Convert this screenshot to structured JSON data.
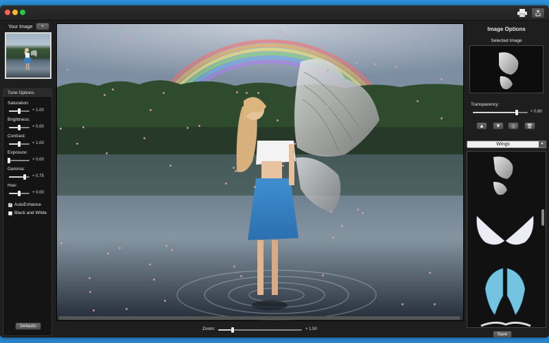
{
  "left_panel": {
    "title": "Your Image",
    "add_label": "+",
    "tune_title": "Tune Options",
    "sliders": [
      {
        "label": "Saturation:",
        "value": "+ 1.00",
        "level": 0.5
      },
      {
        "label": "Brightness:",
        "value": "+ 0.00",
        "level": 0.5
      },
      {
        "label": "Contrast:",
        "value": "+ 1.00",
        "level": 0.5
      },
      {
        "label": "Exposure:",
        "value": "+ 0.00",
        "level": 0.0
      },
      {
        "label": "Gamma:",
        "value": "+ 0.75",
        "level": 0.75
      },
      {
        "label": "Hue:",
        "value": "+ 0.00",
        "level": 0.5
      }
    ],
    "auto_enhance": {
      "label": "AutoEnhance",
      "checked": true
    },
    "black_white": {
      "label": "Black and White",
      "checked": false
    },
    "defaults_label": "Defaults"
  },
  "bottom": {
    "zoom_label": "Zoom:",
    "zoom_value": "+ 1.50",
    "zoom_level": 0.17
  },
  "right_panel": {
    "title": "Image Options",
    "selected_label": "Selected Image",
    "transparency_label": "Transparency:",
    "transparency_value": "+ 0.80",
    "transparency_level": 0.8,
    "category": "Wings",
    "save_label": "Save"
  },
  "colors": {
    "window": "#1e1e1e",
    "panel": "#141414",
    "desktop": "#3aa0e4"
  }
}
